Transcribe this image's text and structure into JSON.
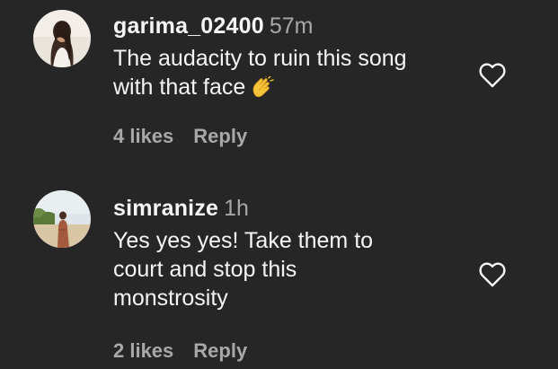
{
  "comments": [
    {
      "username": "garima_02400",
      "time": "57m",
      "text_lines": [
        "The audacity to ruin this song",
        "with that face"
      ],
      "emoji": "clapping-hands",
      "likes": "4 likes",
      "reply": "Reply"
    },
    {
      "username": "simranize",
      "time": "1h",
      "text_lines": [
        "Yes yes yes! Take them to",
        "court and stop this",
        "monstrosity"
      ],
      "likes": "2 likes",
      "reply": "Reply"
    }
  ],
  "icons": {
    "like": "heart-outline-icon"
  },
  "colors": {
    "background": "#262626",
    "primary_text": "#f5f5f5",
    "secondary_text": "#a8a8a8",
    "clap_emoji": "#f7c33b"
  }
}
